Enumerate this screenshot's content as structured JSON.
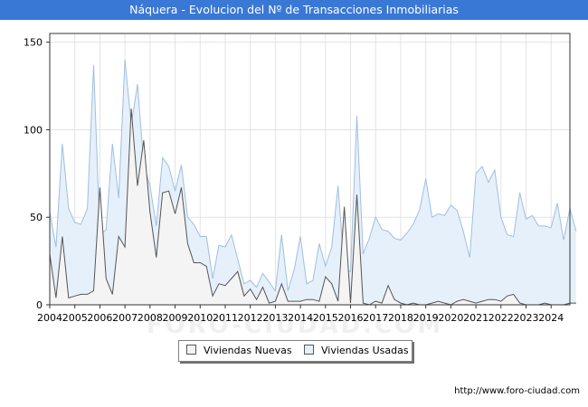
{
  "header": {
    "title": "Náquera - Evolucion del Nº de Transacciones Inmobiliarias"
  },
  "footer": {
    "source": "http://www.foro-ciudad.com"
  },
  "watermark": "FORO-CIUDAD.COM",
  "chart_data": {
    "type": "area",
    "title": "Náquera - Evolucion del Nº de Transacciones Inmobiliarias",
    "xlabel": "",
    "ylabel": "",
    "ylim": [
      0,
      155
    ],
    "yticks": [
      0,
      50,
      100,
      150
    ],
    "xlim": [
      2004,
      2024.75
    ],
    "xticks": [
      "2004",
      "2005",
      "2006",
      "2007",
      "2008",
      "2009",
      "2010",
      "2011",
      "2012",
      "2013",
      "2014",
      "2015",
      "2016",
      "2017",
      "2018",
      "2019",
      "2020",
      "2021",
      "2022",
      "2023",
      "2024"
    ],
    "grid": true,
    "legend_position": "bottom",
    "quarters_start": 2004,
    "series": [
      {
        "name": "Viviendas Nuevas",
        "color": "#f4f4f4",
        "stroke": "#555555",
        "values": [
          29,
          4,
          39,
          4,
          5,
          6,
          6,
          8,
          67,
          15,
          6,
          39,
          33,
          112,
          68,
          94,
          53,
          27,
          64,
          65,
          52,
          67,
          35,
          24,
          24,
          22,
          5,
          12,
          11,
          15,
          19,
          5,
          9,
          3,
          10,
          1,
          2,
          12,
          2,
          2,
          2,
          3,
          3,
          2,
          16,
          12,
          2,
          56,
          1,
          63,
          1,
          0,
          2,
          1,
          11,
          3,
          1,
          0,
          1,
          0,
          0,
          1,
          2,
          1,
          0,
          2,
          3,
          2,
          1,
          2,
          3,
          3,
          2,
          5,
          6,
          1,
          0,
          0,
          0,
          1,
          0,
          0,
          0,
          1,
          1
        ]
      },
      {
        "name": "Viviendas Usadas",
        "color": "#e6f0fb",
        "stroke": "#9fbfdf",
        "values": [
          53,
          33,
          92,
          55,
          47,
          46,
          55,
          137,
          40,
          43,
          92,
          61,
          140,
          103,
          126,
          80,
          68,
          45,
          84,
          79,
          65,
          80,
          50,
          46,
          39,
          39,
          15,
          34,
          33,
          40,
          26,
          12,
          14,
          10,
          18,
          13,
          8,
          40,
          8,
          20,
          39,
          12,
          14,
          35,
          22,
          33,
          68,
          20,
          19,
          108,
          29,
          38,
          50,
          43,
          42,
          38,
          37,
          41,
          46,
          54,
          72,
          50,
          52,
          51,
          57,
          54,
          42,
          27,
          75,
          79,
          70,
          77,
          50,
          40,
          39,
          64,
          49,
          51,
          45,
          45,
          44,
          58,
          37,
          55,
          42
        ]
      }
    ]
  }
}
